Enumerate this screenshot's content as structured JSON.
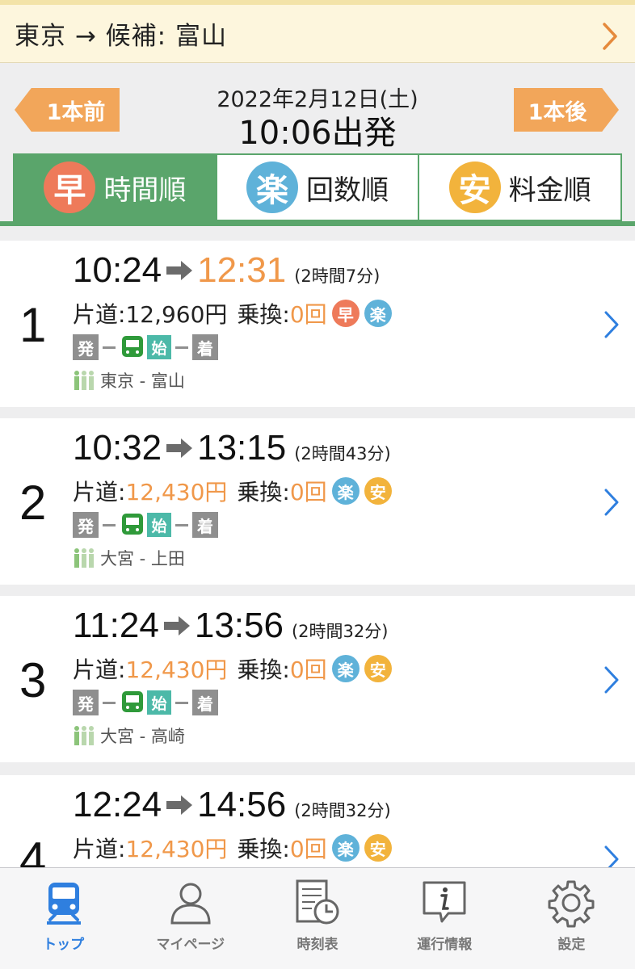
{
  "route": {
    "text": "東京 → 候補: 富山"
  },
  "header": {
    "prev_label": "1本前",
    "next_label": "1本後",
    "date": "2022年2月12日(土)",
    "departure": "10:06出発"
  },
  "sort_tabs": [
    {
      "icon": "早",
      "label": "時間順",
      "active": true,
      "color": "#ee7a5a"
    },
    {
      "icon": "楽",
      "label": "回数順",
      "active": false,
      "color": "#5fb2d9"
    },
    {
      "icon": "安",
      "label": "料金順",
      "active": false,
      "color": "#f2b33c"
    }
  ],
  "results": [
    {
      "num": "1",
      "dep": "10:24",
      "arr": "12:31",
      "arr_highlight": true,
      "duration": "(2時間7分)",
      "fare_label": "片道:",
      "fare": "12,960円",
      "fare_highlight": false,
      "xfer_label": "乗換:",
      "xfer": "0回",
      "badges": [
        "早",
        "楽"
      ],
      "stops": {
        "dep": "発",
        "start": "始",
        "arr": "着"
      },
      "trains": "東京 - 富山"
    },
    {
      "num": "2",
      "dep": "10:32",
      "arr": "13:15",
      "arr_highlight": false,
      "duration": "(2時間43分)",
      "fare_label": "片道:",
      "fare": "12,430円",
      "fare_highlight": true,
      "xfer_label": "乗換:",
      "xfer": "0回",
      "badges": [
        "楽",
        "安"
      ],
      "stops": {
        "dep": "発",
        "start": "始",
        "arr": "着"
      },
      "trains": "大宮 - 上田"
    },
    {
      "num": "3",
      "dep": "11:24",
      "arr": "13:56",
      "arr_highlight": false,
      "duration": "(2時間32分)",
      "fare_label": "片道:",
      "fare": "12,430円",
      "fare_highlight": true,
      "xfer_label": "乗換:",
      "xfer": "0回",
      "badges": [
        "楽",
        "安"
      ],
      "stops": {
        "dep": "発",
        "start": "始",
        "arr": "着"
      },
      "trains": "大宮 - 高崎"
    },
    {
      "num": "4",
      "dep": "12:24",
      "arr": "14:56",
      "arr_highlight": false,
      "duration": "(2時間32分)",
      "fare_label": "片道:",
      "fare": "12,430円",
      "fare_highlight": true,
      "xfer_label": "乗換:",
      "xfer": "0回",
      "badges": [
        "楽",
        "安"
      ]
    }
  ],
  "tabbar": [
    {
      "icon": "train-icon",
      "label": "トップ",
      "active": true
    },
    {
      "icon": "person-icon",
      "label": "マイページ",
      "active": false
    },
    {
      "icon": "timetable-icon",
      "label": "時刻表",
      "active": false
    },
    {
      "icon": "info-icon",
      "label": "運行情報",
      "active": false
    },
    {
      "icon": "gear-icon",
      "label": "設定",
      "active": false
    }
  ],
  "colors": {
    "green": "#5aa56b",
    "orange": "#f0984a",
    "blue": "#2f7fdf"
  }
}
